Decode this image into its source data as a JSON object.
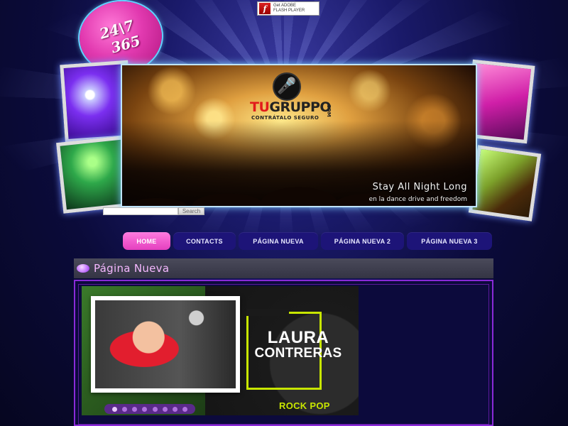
{
  "flash_badge": {
    "line1": "Get ADOBE",
    "line2": "FLASH PLAYER",
    "icon": "flash-icon"
  },
  "badge": {
    "line1": "24\\7",
    "line2": "365"
  },
  "hero": {
    "logo_name_red": "TU",
    "logo_name_dark": "GRUPPO",
    "logo_com": ".COM",
    "logo_tag": "CONTRÁTALO SEGURO",
    "logo_icon": "microphone-icon",
    "title": "Stay All Night Long",
    "subtitle": "en la dance drive and freedom"
  },
  "search": {
    "placeholder": "",
    "button_label": "Search"
  },
  "nav": {
    "items": [
      {
        "label": "HOME",
        "active": true
      },
      {
        "label": "CONTACTS",
        "active": false
      },
      {
        "label": "PÁGINA NUEVA",
        "active": false
      },
      {
        "label": "PÁGINA NUEVA 2",
        "active": false
      },
      {
        "label": "PÁGINA NUEVA 3",
        "active": false
      }
    ]
  },
  "page": {
    "title": "Página Nueva"
  },
  "feature": {
    "first_name": "LAURA",
    "last_name": "CONTRERAS",
    "genre": "ROCK POP",
    "slides_total": 8,
    "slide_active": 1
  },
  "colors": {
    "nav_active": "#e43fbf",
    "nav_default": "#1d1478",
    "title_text": "#f5b8ff",
    "genre": "#c8e600",
    "border_accent": "#8a2ad8"
  }
}
